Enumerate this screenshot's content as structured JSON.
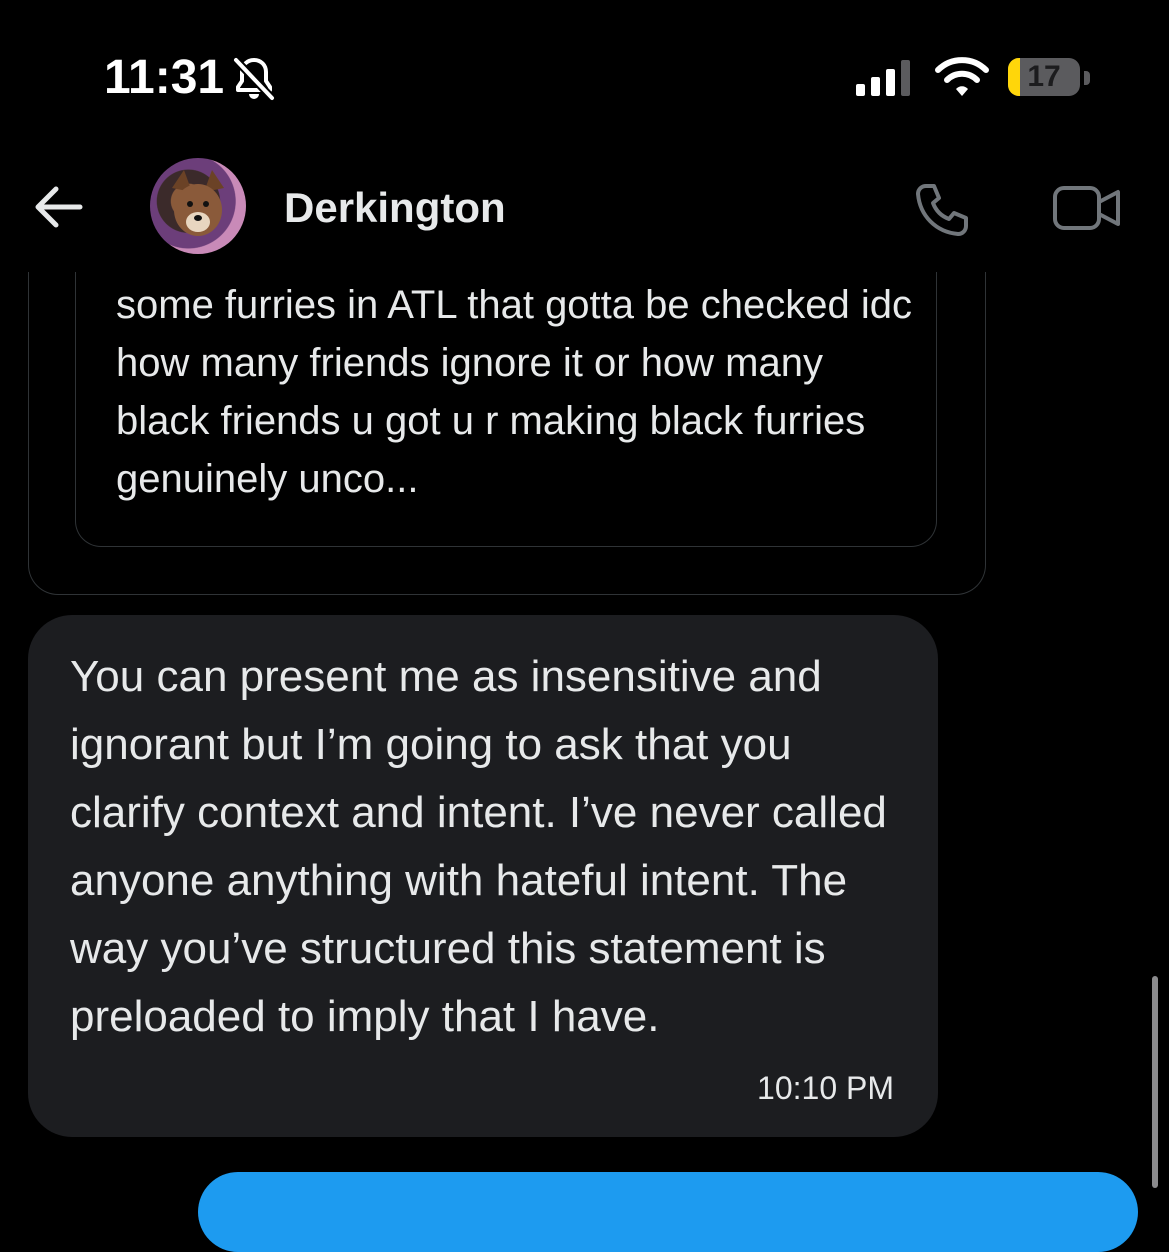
{
  "status_bar": {
    "time": "11:31",
    "battery_level": "17",
    "battery_fraction": 0.17,
    "icons": [
      "bell-slash-icon",
      "cellular-signal-icon",
      "wifi-icon",
      "battery-icon"
    ]
  },
  "header": {
    "back_icon": "arrow-left-icon",
    "contact_name": "Derkington",
    "actions": [
      "phone-icon",
      "video-icon"
    ]
  },
  "quoted_message": {
    "text": "some furries in ATL that gotta be checked idc how many friends ignore it or how many black friends u got u r making black furries genuinely unco..."
  },
  "message": {
    "text": "You can present me as insensitive and ignorant but I’m going to ask that you clarify context and intent. I’ve never called anyone anything with hateful intent. The way you’ve structured this statement is preloaded to imply that I have.",
    "timestamp": "10:10 PM"
  },
  "colors": {
    "background": "#000000",
    "incoming_bubble": "#1c1d20",
    "outgoing_bubble": "#1d9bf0",
    "battery_low": "#ffd60a"
  }
}
